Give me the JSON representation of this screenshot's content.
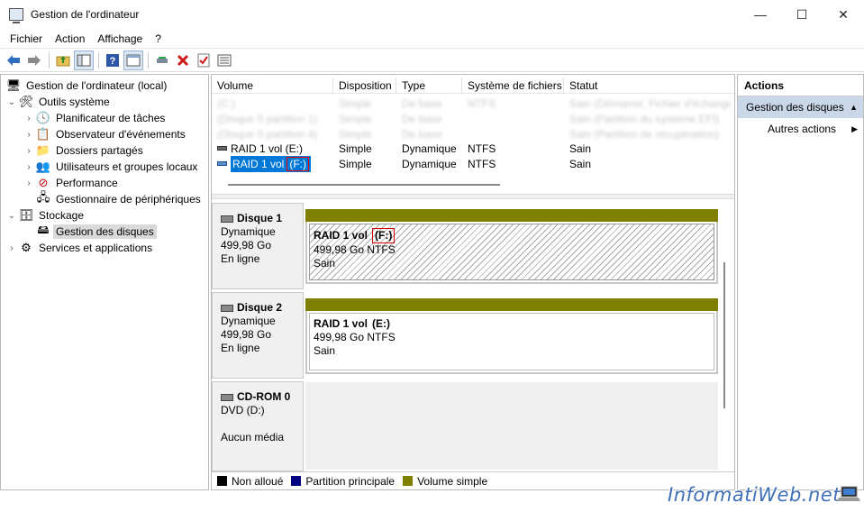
{
  "window": {
    "title": "Gestion de l'ordinateur",
    "minimize_glyph": "—",
    "maximize_glyph": "☐",
    "close_glyph": "✕"
  },
  "menu": [
    "Fichier",
    "Action",
    "Affichage",
    "?"
  ],
  "toolbar": {
    "icons": [
      "back-icon",
      "forward-icon",
      "up-folder-icon",
      "show-hide-tree-icon",
      "help-icon",
      "view-icon",
      "properties-icon",
      "delete-icon",
      "check-icon",
      "list-icon"
    ]
  },
  "tree": {
    "root": "Gestion de l'ordinateur (local)",
    "system_tools": "Outils système",
    "task_scheduler": "Planificateur de tâches",
    "event_viewer": "Observateur d'événements",
    "shared_folders": "Dossiers partagés",
    "users_groups": "Utilisateurs et groupes locaux",
    "performance": "Performance",
    "device_manager": "Gestionnaire de périphériques",
    "storage": "Stockage",
    "disk_management": "Gestion des disques",
    "services_apps": "Services et applications"
  },
  "volumes": {
    "columns": [
      "Volume",
      "Disposition",
      "Type",
      "Système de fichiers",
      "Statut"
    ],
    "rows": [
      {
        "volume": "(C:)",
        "disposition": "Simple",
        "type": "De base",
        "fs": "NTFS",
        "status": "Sain (Démarrer, Fichier d'échange)",
        "blurred": true
      },
      {
        "volume": "(Disque 0 partition 1)",
        "disposition": "Simple",
        "type": "De base",
        "fs": "",
        "status": "Sain (Partition du système EFI)",
        "blurred": true
      },
      {
        "volume": "(Disque 0 partition 4)",
        "disposition": "Simple",
        "type": "De base",
        "fs": "",
        "status": "Sain (Partition de récupération)",
        "blurred": true
      },
      {
        "volume": "RAID 1 vol (E:)",
        "disposition": "Simple",
        "type": "Dynamique",
        "fs": "NTFS",
        "status": "Sain",
        "blurred": false
      },
      {
        "volume_name": "RAID 1 vol",
        "volume_letter": "(F:)",
        "disposition": "Simple",
        "type": "Dynamique",
        "fs": "NTFS",
        "status": "Sain",
        "blurred": false,
        "selected": true
      }
    ]
  },
  "disks": [
    {
      "name": "Disque 1",
      "kind": "Dynamique",
      "size": "499,98 Go",
      "state": "En ligne",
      "partition": {
        "name": "RAID 1 vol",
        "letter": "(F:)",
        "size_fs": "499,98 Go NTFS",
        "status": "Sain"
      }
    },
    {
      "name": "Disque 2",
      "kind": "Dynamique",
      "size": "499,98 Go",
      "state": "En ligne",
      "partition": {
        "name": "RAID 1 vol",
        "letter": "(E:)",
        "size_fs": "499,98 Go NTFS",
        "status": "Sain"
      }
    },
    {
      "name": "CD-ROM 0",
      "kind": "DVD (D:)",
      "size": "",
      "state": "Aucun média"
    }
  ],
  "legend": [
    {
      "label": "Non alloué",
      "color": "#000000"
    },
    {
      "label": "Partition principale",
      "color": "#000080"
    },
    {
      "label": "Volume simple",
      "color": "#808000"
    }
  ],
  "actions": {
    "title": "Actions",
    "section": "Gestion des disques",
    "more": "Autres actions"
  },
  "watermark": "InformatiWeb.net"
}
